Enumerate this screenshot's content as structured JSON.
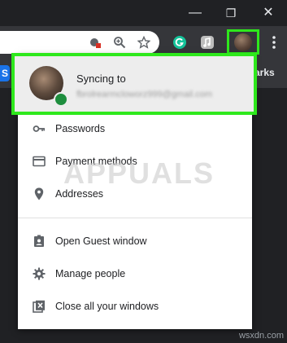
{
  "window": {
    "minimize_glyph": "—",
    "restore_glyph": "❐",
    "close_glyph": "✕"
  },
  "toolbar": {
    "icons": [
      "incognito-blocked-icon",
      "zoom-icon",
      "star-icon",
      "grammarly-icon",
      "music-extension-icon",
      "profile-avatar-icon",
      "more-vert-icon"
    ]
  },
  "bookmarks_bar": {
    "first_label": "S",
    "last_label": "arks"
  },
  "menu": {
    "sync": {
      "title": "Syncing to",
      "email": "fbrolrearmcloworz999@gmail.com"
    },
    "items": [
      {
        "label": "Passwords",
        "icon": "key-icon"
      },
      {
        "label": "Payment methods",
        "icon": "credit-card-icon"
      },
      {
        "label": "Addresses",
        "icon": "location-pin-icon"
      },
      {
        "label": "Open Guest window",
        "icon": "guest-badge-icon"
      },
      {
        "label": "Manage people",
        "icon": "gear-icon"
      },
      {
        "label": "Close all your windows",
        "icon": "close-windows-icon"
      }
    ]
  },
  "watermark": {
    "text": "APPUALS",
    "credit": "wsxdn.com"
  },
  "colors": {
    "highlight": "#2ee81c",
    "toolbar": "#35363a",
    "frame": "#202124",
    "sync_badge": "#1e8e3e"
  }
}
